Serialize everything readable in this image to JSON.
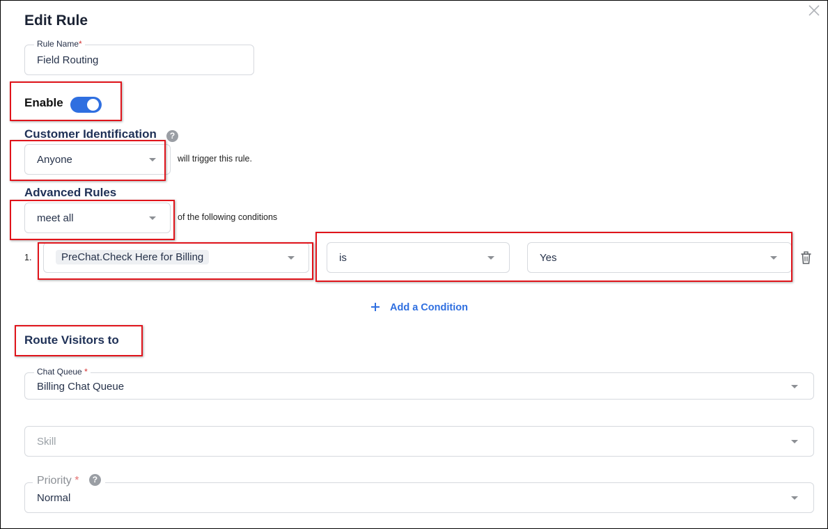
{
  "dialog": {
    "title": "Edit Rule"
  },
  "rule_name": {
    "label": "Rule Name",
    "required_mark": "*",
    "value": "Field Routing"
  },
  "enable": {
    "label": "Enable",
    "on": true
  },
  "customer_identification": {
    "heading": "Customer Identification",
    "selected": "Anyone",
    "suffix": "will trigger this rule."
  },
  "advanced_rules": {
    "heading": "Advanced Rules",
    "selected": "meet all",
    "suffix": "of the following conditions",
    "conditions": [
      {
        "index": "1.",
        "field": "PreChat.Check Here for Billing",
        "operator": "is",
        "value": "Yes"
      }
    ],
    "add_label": "Add a Condition"
  },
  "route": {
    "heading": "Route Visitors to",
    "chat_queue": {
      "label": "Chat Queue",
      "required_mark": "*",
      "value": "Billing Chat Queue"
    },
    "skill": {
      "placeholder": "Skill"
    },
    "priority": {
      "label": "Priority",
      "required_mark": "*",
      "value": "Normal"
    }
  },
  "colors": {
    "accent": "#2f6fe0",
    "annotation": "#e0141b"
  }
}
